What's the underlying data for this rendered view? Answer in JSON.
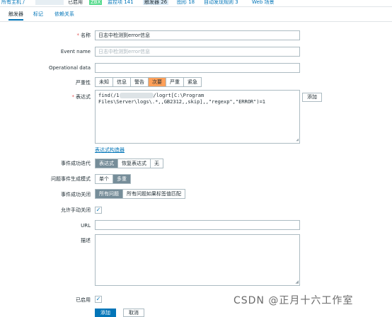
{
  "topbar": {
    "all_hosts": "所有主机 /",
    "enabled": "已启用",
    "zbx": "ZBX",
    "items": "监控项 141",
    "triggers": "触发器 26",
    "graphs": "图形 18",
    "discovery": "自动发现规则 3",
    "web": "Web 场景"
  },
  "tabs": {
    "trigger": "触发器",
    "tags": "标记",
    "dependencies": "依赖关系"
  },
  "form": {
    "name_label": "名称",
    "name_value": "日志中检测到error信息",
    "event_name_label": "Event name",
    "event_name_placeholder": "日志中检测到error信息",
    "opdata_label": "Operational data",
    "severity_label": "严重性",
    "severity_options": [
      "未知",
      "信息",
      "警告",
      "次要",
      "严重",
      "紧急"
    ],
    "severity_selected": "次要",
    "expression_label": "表达式",
    "expression_prefix": "find(/1",
    "expression_rest": "/logrt[C:\\Program Files\\Server\\logs\\.*,,GB2312,,skip],,\"regexp\",\"ERROR\")=1",
    "add_button": "添加",
    "constructor_link": "表达式构造器",
    "ok_event_label": "事件成功迭代",
    "ok_event_options": [
      "表达式",
      "恢复表达式",
      "无"
    ],
    "mode_label": "问题事件生成模式",
    "mode_options": [
      "单个",
      "多重"
    ],
    "ok_close_label": "事件成功关闭",
    "ok_close_options": [
      "所有问题",
      "所有问题如果标签值匹配"
    ],
    "manual_close_label": "允许手动关闭",
    "url_label": "URL",
    "desc_label": "描述",
    "enabled_label": "已启用",
    "submit": "添加",
    "cancel": "取消",
    "checkmark": "✓",
    "required_mark": "*",
    "grip": "◢"
  },
  "watermark": "CSDN @正月十六工作室",
  "colors": {
    "accent": "#0275b8",
    "severity_selected": "#ffa059",
    "toggle_selected": "#768d99"
  }
}
